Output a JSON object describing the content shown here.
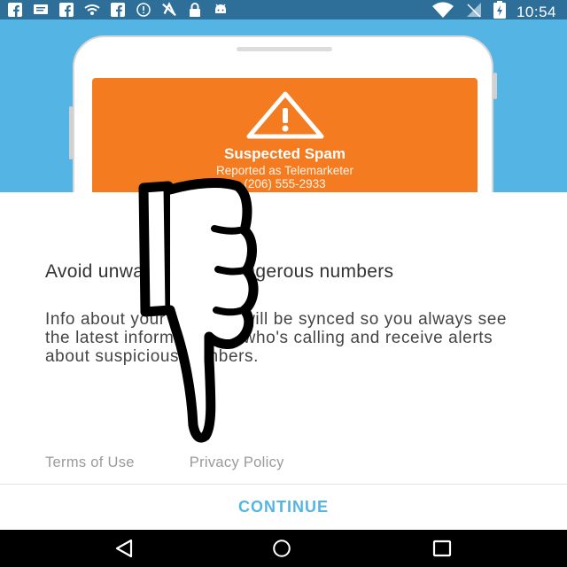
{
  "status_bar": {
    "left_icons": [
      "facebook-icon",
      "message-icon",
      "facebook-icon",
      "wifi-sync-icon",
      "facebook-icon",
      "info-icon",
      "no-sync-icon",
      "lock-icon",
      "android-icon"
    ],
    "right_icons": [
      "wifi-icon",
      "no-signal-icon",
      "battery-charging-icon"
    ],
    "time": "10:54"
  },
  "phone_preview": {
    "spam_title": "Suspected Spam",
    "spam_subtitle": "Reported as Telemarketer",
    "phone_number": "(206) 555-2933"
  },
  "main": {
    "title": "Avoid unwanted and dangerous numbers",
    "body": "Info about your contacts will be synced so you always see the latest information on who's calling and receive alerts about suspicious numbers.",
    "terms_link": "Terms of Use",
    "privacy_link": "Privacy Policy",
    "continue_label": "CONTINUE"
  },
  "nav_bar": {
    "buttons": [
      "back-icon",
      "home-icon",
      "recents-icon"
    ]
  },
  "colors": {
    "status_bar": "#2e6f99",
    "header": "#54b4e3",
    "spam_card": "#f47b20",
    "accent": "#54b4e3"
  }
}
